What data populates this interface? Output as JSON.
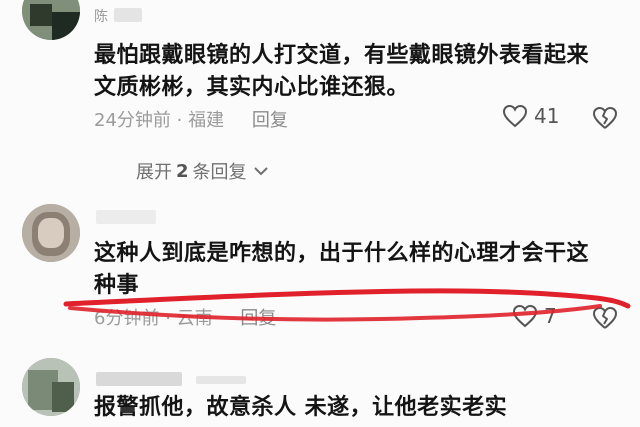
{
  "comments": [
    {
      "username": "陈",
      "text_lines": [
        "最怕跟戴眼镜的人打交道，有些戴眼镜外表看起来",
        "文质彬彬，其实内心比谁还狠。"
      ],
      "time": "24分钟前",
      "location": "福建",
      "reply_label": "回复",
      "likes": "41"
    },
    {
      "username": "",
      "text_lines": [
        "这种人到底是咋想的，出于什么样的心理才会干这",
        "种事"
      ],
      "time": "6分钟前",
      "location": "云南",
      "reply_label": "回复",
      "likes": "7"
    },
    {
      "username": "",
      "text_lines": [
        "报警抓他，故意杀人 未遂，让他老实老实"
      ],
      "time": "",
      "location": "",
      "reply_label": "",
      "likes": ""
    }
  ],
  "expand_replies": {
    "prefix": "展开",
    "count": "2",
    "suffix": "条回复"
  },
  "colors": {
    "annotation_line": "#e0212b",
    "meta_text": "#9b9b9b"
  },
  "icons": [
    "heart-icon",
    "broken-heart-icon",
    "chevron-down-icon"
  ]
}
